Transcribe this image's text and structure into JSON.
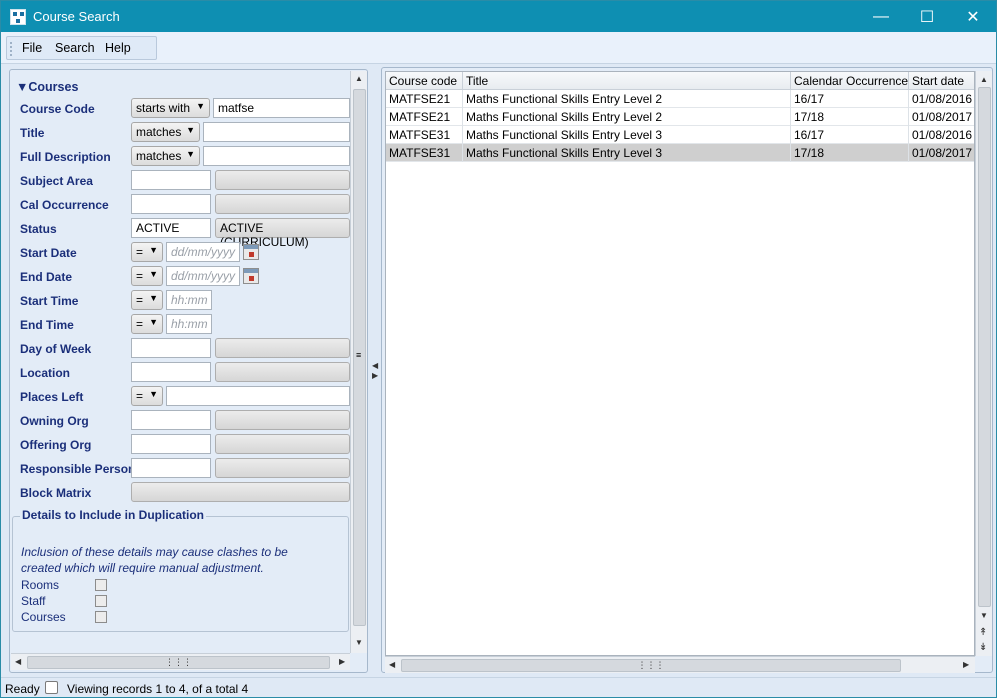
{
  "window": {
    "title": "Course Search",
    "controls": [
      "minimize-icon",
      "maximize-icon",
      "close-icon"
    ]
  },
  "menu": {
    "items": [
      "File",
      "Search",
      "Help"
    ]
  },
  "filter_panel": {
    "section_title": "▼Courses",
    "fields": [
      {
        "label": "Course Code",
        "operator": "starts with",
        "value": "matfse"
      },
      {
        "label": "Title",
        "operator": "matches",
        "value": ""
      },
      {
        "label": "Full Description",
        "operator": "matches",
        "value": ""
      },
      {
        "label": "Subject Area",
        "value": "",
        "lookup": ""
      },
      {
        "label": "Cal Occurrence",
        "value": "",
        "lookup": ""
      },
      {
        "label": "Status",
        "value": "ACTIVE",
        "lookup": "ACTIVE (CURRICULUM)"
      },
      {
        "label": "Start Date",
        "operator": "=",
        "placeholder": "dd/mm/yyyy"
      },
      {
        "label": "End Date",
        "operator": "=",
        "placeholder": "dd/mm/yyyy"
      },
      {
        "label": "Start Time",
        "operator": "=",
        "placeholder": "hh:mm"
      },
      {
        "label": "End Time",
        "operator": "=",
        "placeholder": "hh:mm"
      },
      {
        "label": "Day of Week",
        "value": "",
        "lookup": ""
      },
      {
        "label": "Location",
        "value": "",
        "lookup": ""
      },
      {
        "label": "Places Left",
        "operator": "=",
        "value": ""
      },
      {
        "label": "Owning Org",
        "value": "",
        "lookup": ""
      },
      {
        "label": "Offering Org",
        "value": "",
        "lookup": ""
      },
      {
        "label": "Responsible Person",
        "value": "",
        "lookup": ""
      },
      {
        "label": "Block Matrix",
        "lookup": ""
      }
    ],
    "duplication": {
      "title": "Details to Include in Duplication",
      "note": "Inclusion of these details may cause clashes to be created which will require manual adjustment.",
      "options": [
        {
          "label": "Rooms",
          "checked": false
        },
        {
          "label": "Staff",
          "checked": false
        },
        {
          "label": "Courses",
          "checked": false
        }
      ]
    }
  },
  "results": {
    "columns": [
      "Course code",
      "Title",
      "Calendar Occurrence",
      "Start date"
    ],
    "rows": [
      [
        "MATFSE21",
        "Maths Functional Skills Entry Level 2",
        "16/17",
        "01/08/2016"
      ],
      [
        "MATFSE21",
        "Maths Functional Skills Entry Level 2",
        "17/18",
        "01/08/2017"
      ],
      [
        "MATFSE31",
        "Maths Functional Skills Entry Level 3",
        "16/17",
        "01/08/2016"
      ],
      [
        "MATFSE31",
        "Maths Functional Skills Entry Level 3",
        "17/18",
        "01/08/2017"
      ]
    ],
    "selected_row": 3
  },
  "status": {
    "ready": "Ready",
    "text": "Viewing records 1 to 4, of a total 4"
  },
  "colors": {
    "titlebar": "#0e8fb2",
    "label": "#1b2f7a",
    "selected_row": "#cfcfcf"
  }
}
